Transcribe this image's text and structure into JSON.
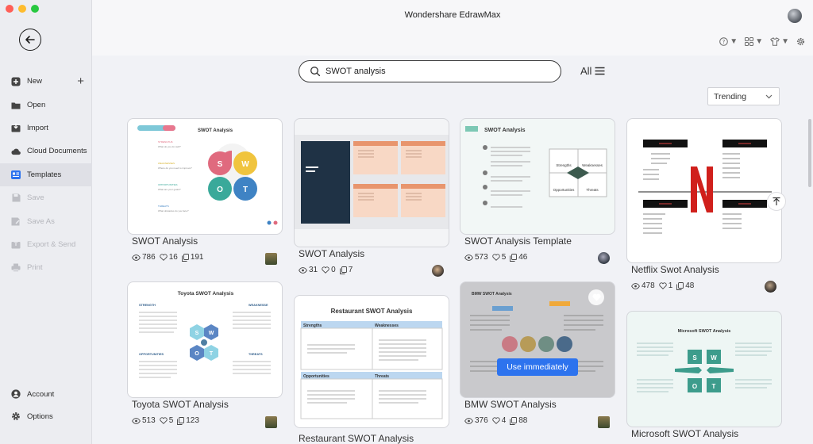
{
  "window": {
    "title": "Wondershare EdrawMax"
  },
  "colors": {
    "accent": "#2d73ee",
    "close": "#ff5f57",
    "minimize": "#febc2e",
    "maximize": "#28c840"
  },
  "sidebar": {
    "back": "back-arrow-icon",
    "items": [
      {
        "label": "New",
        "icon": "plus-square-icon"
      },
      {
        "label": "Open",
        "icon": "folder-icon"
      },
      {
        "label": "Import",
        "icon": "import-icon"
      },
      {
        "label": "Cloud Documents",
        "icon": "cloud-icon"
      },
      {
        "label": "Templates",
        "icon": "templates-icon"
      },
      {
        "label": "Save",
        "icon": "save-icon"
      },
      {
        "label": "Save As",
        "icon": "save-as-icon"
      },
      {
        "label": "Export & Send",
        "icon": "export-icon"
      },
      {
        "label": "Print",
        "icon": "print-icon"
      }
    ],
    "bottom": [
      {
        "label": "Account",
        "icon": "account-icon"
      },
      {
        "label": "Options",
        "icon": "gear-icon"
      }
    ]
  },
  "search": {
    "value": "SWOT analysis",
    "placeholder": "Search"
  },
  "filter": {
    "label": "All"
  },
  "sort": {
    "value": "Trending"
  },
  "cards": [
    {
      "title": "SWOT Analysis",
      "views": "786",
      "likes": "16",
      "copies": "191"
    },
    {
      "title": "SWOT Analysis",
      "views": "31",
      "likes": "0",
      "copies": "7"
    },
    {
      "title": "SWOT Analysis Template",
      "views": "573",
      "likes": "5",
      "copies": "46"
    },
    {
      "title": "Netflix Swot Analysis",
      "views": "478",
      "likes": "1",
      "copies": "48"
    },
    {
      "title": "Toyota SWOT Analysis",
      "views": "513",
      "likes": "5",
      "copies": "123"
    },
    {
      "title": "Restaurant SWOT Analysis",
      "views": "",
      "likes": "",
      "copies": ""
    },
    {
      "title": "BMW SWOT Analysis",
      "views": "376",
      "likes": "4",
      "copies": "88"
    },
    {
      "title": "Microsoft SWOT Analysis",
      "views": "",
      "likes": "",
      "copies": ""
    }
  ],
  "thumbs": {
    "c1": {
      "title": "SWOT Analysis",
      "letters": [
        "S",
        "W",
        "O",
        "T"
      ]
    },
    "c3": {
      "title": "SWOT Analysis",
      "q1": "Strengths",
      "q2": "Weaknesses",
      "q3": "Opportunities",
      "q4": "Threats"
    },
    "c5": {
      "title": "Toyota SWOT Analysis",
      "l1": "STRENGTH",
      "l2": "OPPORTUNITIES",
      "r1": "WEAKNESSE",
      "r2": "THREATS"
    },
    "c6": {
      "title": "Restaurant SWOT Analysis",
      "h1": "Strengths",
      "h2": "Weaknesses",
      "h3": "Opportunities",
      "h4": "Threats"
    },
    "c7": {
      "title": "BMW SWOT Analysis"
    },
    "c8": {
      "title": "Microsoft SWOT Analysis"
    }
  },
  "use_button": "Use immediately"
}
